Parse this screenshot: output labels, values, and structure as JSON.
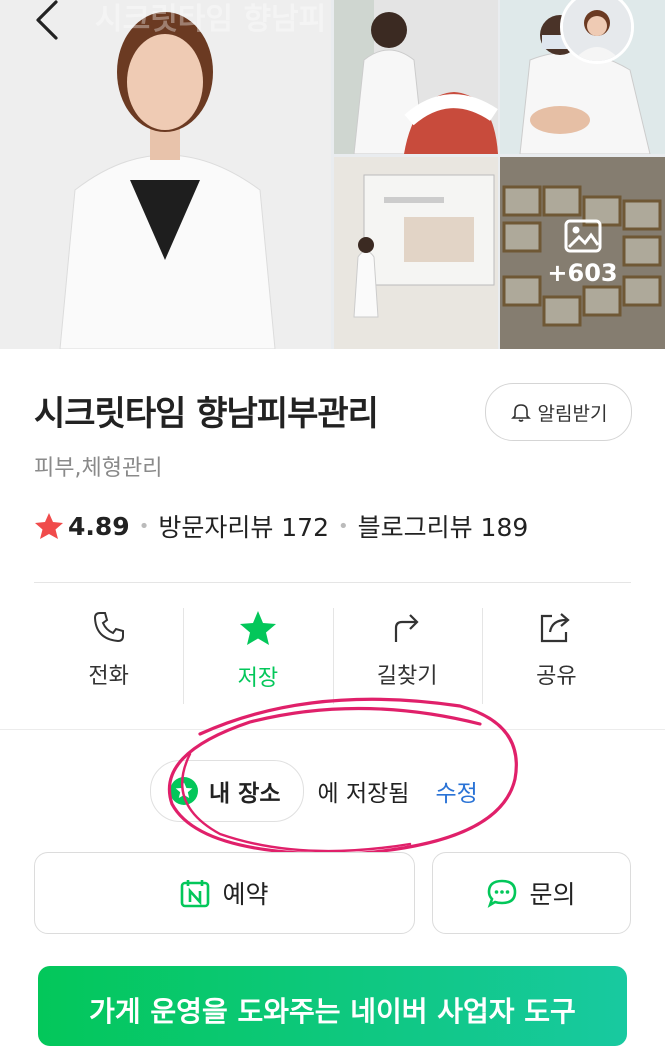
{
  "header": {
    "ghost_title": "시크릿타임 향남피"
  },
  "gallery": {
    "more_count": "+603"
  },
  "place": {
    "name": "시크릿타임 향남피부관리",
    "notify_label": "알림받기",
    "category": "피부,체형관리",
    "rating": "4.89",
    "visitor_reviews": "방문자리뷰 172",
    "blog_reviews": "블로그리뷰 189"
  },
  "actions": [
    {
      "label": "전화",
      "icon": "phone-icon"
    },
    {
      "label": "저장",
      "icon": "star-icon"
    },
    {
      "label": "길찾기",
      "icon": "directions-icon"
    },
    {
      "label": "공유",
      "icon": "share-icon"
    }
  ],
  "saved": {
    "chip_label": "내 장소",
    "saved_text": "에 저장됨",
    "edit_label": "수정"
  },
  "buttons": {
    "reserve_label": "예약",
    "inquiry_label": "문의"
  },
  "banner": {
    "text": "가게 운영을 도와주는 네이버 사업자 도구"
  },
  "colors": {
    "accent_green": "#03c75a",
    "star_red": "#f04b4b",
    "link_blue": "#2a73d6",
    "annotation_pink": "#e0206a"
  }
}
